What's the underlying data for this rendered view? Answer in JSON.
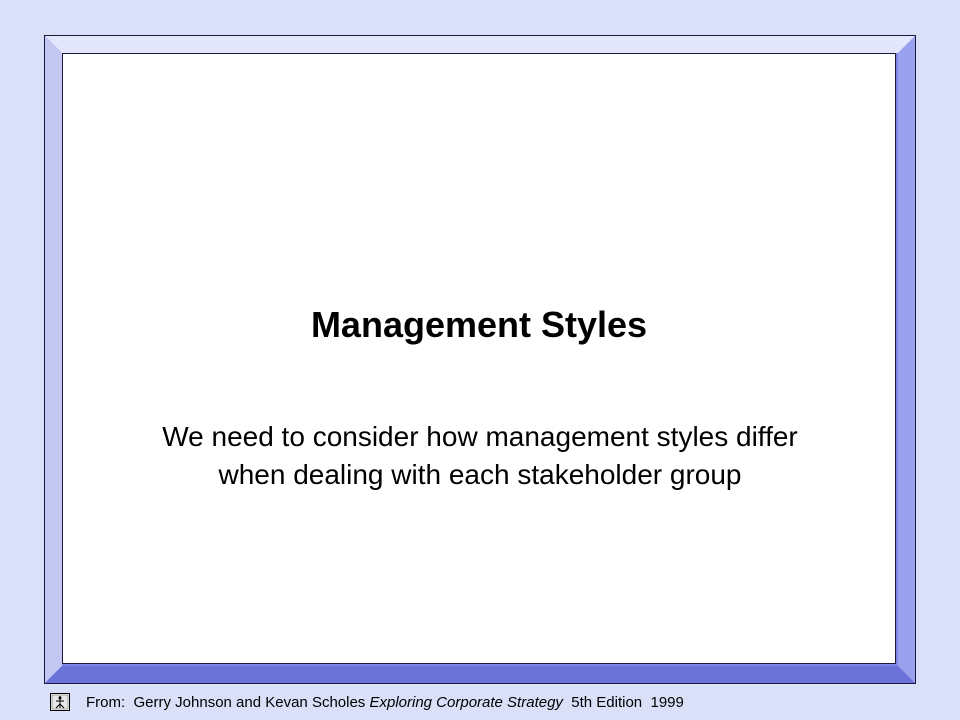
{
  "slide": {
    "title": "Management Styles",
    "body": "We need to consider how management styles differ when dealing with each stakeholder group"
  },
  "footer": {
    "icon": "book-icon",
    "prefix": "From:  Gerry Johnson and Kevan Scholes ",
    "book_title": "Exploring Corporate Strategy",
    "suffix": "  5th Edition  1999"
  },
  "colors": {
    "background": "#dbe0f9",
    "frame": "#7f86e6",
    "content": "#ffffff"
  }
}
